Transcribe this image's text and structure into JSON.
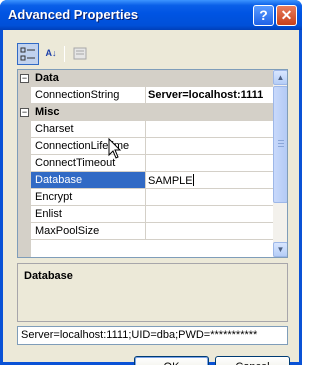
{
  "window": {
    "title": "Advanced Properties"
  },
  "titlebar_buttons": {
    "help": "?",
    "close": "✕"
  },
  "toolbar": {
    "categorized_icon": "categorized-icon",
    "alphabetical_label": "A↓",
    "property_pages_icon": "property-pages-icon"
  },
  "grid": {
    "categories": [
      {
        "expander": "⊟",
        "label": "Data"
      },
      {
        "expander": "⊟",
        "label": "Misc"
      }
    ],
    "rows": [
      {
        "name": "ConnectionString",
        "value": "Server=localhost:1111"
      },
      {
        "name": "Charset",
        "value": ""
      },
      {
        "name": "ConnectionLifetime",
        "value": ""
      },
      {
        "name": "ConnectTimeout",
        "value": ""
      },
      {
        "name": "Database",
        "value": "SAMPLE"
      },
      {
        "name": "Encrypt",
        "value": ""
      },
      {
        "name": "Enlist",
        "value": ""
      },
      {
        "name": "MaxPoolSize",
        "value": ""
      }
    ],
    "scrollbar": {
      "up_glyph": "▲",
      "down_glyph": "▼"
    }
  },
  "help_pane": {
    "title": "Database"
  },
  "connection_string": "Server=localhost:1111;UID=dba;PWD=***********",
  "buttons": {
    "ok": "OK",
    "cancel": "Cancel"
  },
  "colors": {
    "selection": "#316ac5",
    "titlebar": "#0054e3",
    "dialog_bg": "#ece9d8"
  }
}
